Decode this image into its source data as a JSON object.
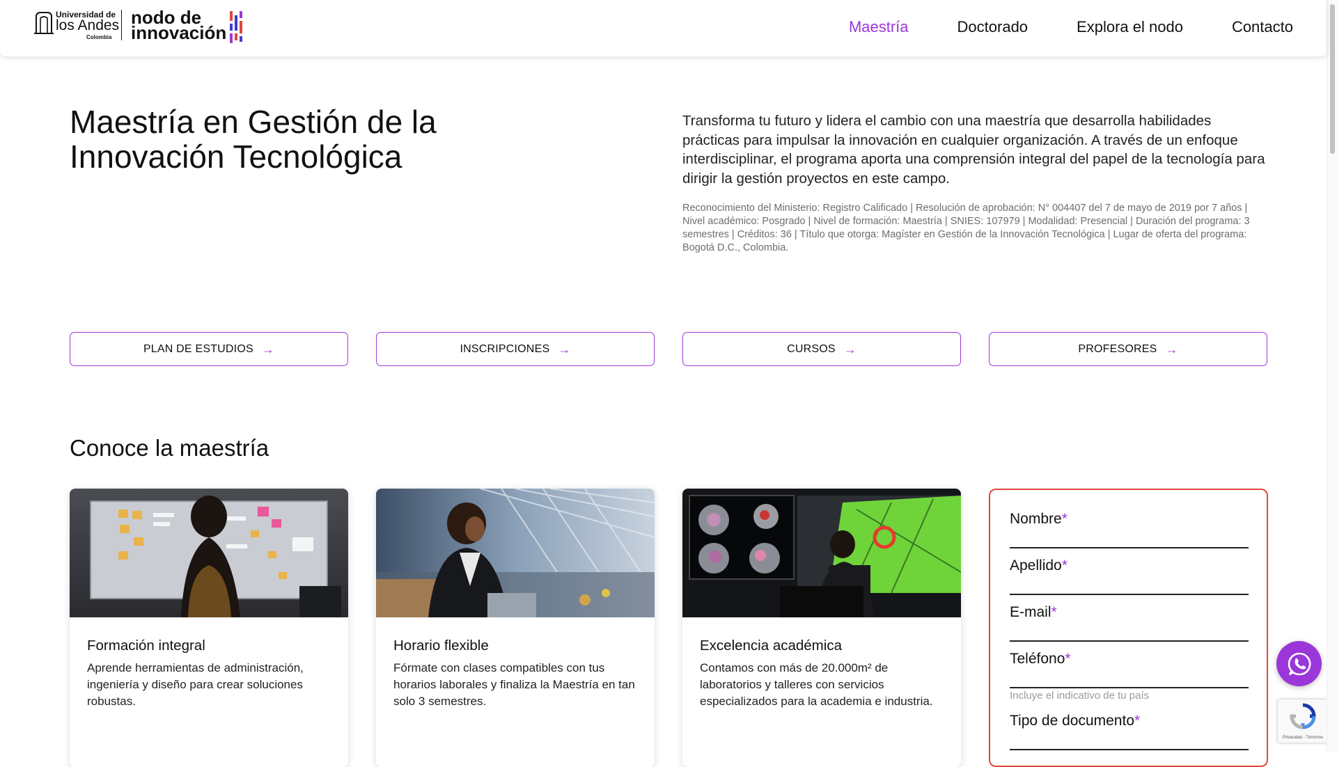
{
  "header": {
    "uniandes_logo": {
      "line1": "Universidad de",
      "line2": "los Andes",
      "line3": "Colombia"
    },
    "nodo_logo": {
      "line1": "nodo de",
      "line2": "innovación"
    },
    "nav": [
      {
        "label": "Maestría",
        "active": true
      },
      {
        "label": "Doctorado",
        "active": false
      },
      {
        "label": "Explora el nodo",
        "active": false
      },
      {
        "label": "Contacto",
        "active": false
      }
    ]
  },
  "hero": {
    "title": "Maestría en Gestión de la Innovación Tecnológica",
    "description": "Transforma tu futuro y lidera el cambio con una maestría que desarrolla habilidades prácticas para impulsar la innovación en cualquier organización. A través de un enfoque interdisciplinar, el programa aporta una comprensión integral del papel de la tecnología para dirigir la gestión proyectos en este campo.",
    "legal": "Reconocimiento del Ministerio: Registro Calificado | Resolución de aprobación: N° 004407 del 7 de mayo de 2019 por 7 años | Nivel académico: Posgrado | Nivel de formación: Maestría | SNIES: 107979 | Modalidad: Presencial | Duración del programa: 3 semestres | Créditos: 36 | Título que otorga: Magíster en Gestión de la Innovación Tecnológica | Lugar de oferta del programa: Bogotá D.C., Colombia."
  },
  "buttons": [
    {
      "label": "PLAN DE ESTUDIOS"
    },
    {
      "label": "INSCRIPCIONES"
    },
    {
      "label": "CURSOS"
    },
    {
      "label": "PROFESORES"
    }
  ],
  "section": {
    "title": "Conoce la maestría"
  },
  "cards": [
    {
      "title": "Formación integral",
      "text": "Aprende herramientas de administración, ingeniería y diseño para crear soluciones robustas.",
      "image": "woman-at-sticky-note-board"
    },
    {
      "title": "Horario flexible",
      "text": "Fórmate con clases compatibles con tus horarios laborales y finaliza la Maestría en tan solo 3 semestres.",
      "image": "woman-with-laptop-at-airport"
    },
    {
      "title": "Excelencia académica",
      "text": "Contamos con más de 20.000m² de laboratorios y talleres con servicios especializados para la academia e industria.",
      "image": "researcher-at-visualization-screens"
    }
  ],
  "form": {
    "fields": [
      {
        "label": "Nombre",
        "required_mark": "*"
      },
      {
        "label": "Apellido",
        "required_mark": "*"
      },
      {
        "label": "E-mail",
        "required_mark": "*"
      },
      {
        "label": "Teléfono",
        "required_mark": "*",
        "hint": "Incluye el indicativo de tu país"
      },
      {
        "label": "Tipo de documento",
        "required_mark": "*"
      }
    ]
  },
  "floating": {
    "whatsapp_icon": "whatsapp-icon",
    "recaptcha_text": "Privacidad - Términos"
  },
  "colors": {
    "accent": "#9b37d9",
    "form_border": "#e3453a",
    "text": "#111111",
    "muted": "#6d6d6d"
  }
}
